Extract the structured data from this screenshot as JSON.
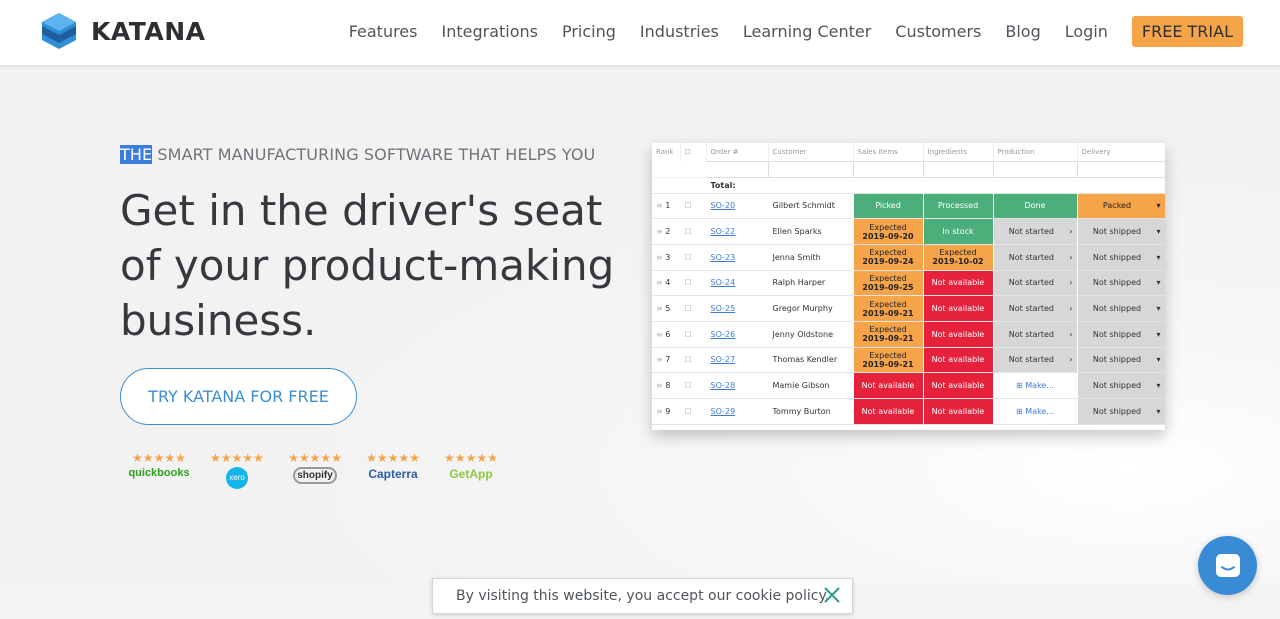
{
  "brand": {
    "logo_text": "KATANA"
  },
  "nav": {
    "items": [
      "Features",
      "Integrations",
      "Pricing",
      "Industries",
      "Learning Center",
      "Customers",
      "Blog",
      "Login"
    ],
    "cta": "FREE TRIAL"
  },
  "hero": {
    "eyebrow_highlight": "THE",
    "eyebrow_rest": " SMART MANUFACTURING SOFTWARE THAT HELPS YOU",
    "headline": "Get in the driver's seat of your product-making business.",
    "cta": "TRY KATANA FOR FREE"
  },
  "badges": [
    {
      "stars": "★★★★★",
      "label": "quickbooks",
      "icon": "quickbooks-logo"
    },
    {
      "stars": "★★★★★",
      "label": "xero",
      "icon": "xero-logo"
    },
    {
      "stars": "★★★★★",
      "label": "shopify",
      "icon": "shopify-logo"
    },
    {
      "stars": "★★★★★",
      "label": "Capterra",
      "icon": "capterra-logo"
    },
    {
      "stars": "★★★★★",
      "label": "GetApp",
      "icon": "getapp-logo"
    }
  ],
  "table": {
    "columns": [
      "Rank",
      "Order #",
      "Customer",
      "Sales items",
      "Ingredients",
      "Production",
      "Delivery"
    ],
    "total_label": "Total:",
    "rows": [
      {
        "rank": "1",
        "order": "SO-20",
        "customer": "Gilbert Schmidt",
        "sales": "Picked",
        "sales_status": "green",
        "ingredients": "Processed",
        "ingredients_status": "green",
        "production": "Done",
        "production_status": "green",
        "delivery": "Packed",
        "delivery_status": "orange"
      },
      {
        "rank": "2",
        "order": "SO-22",
        "customer": "Ellen Sparks",
        "sales": "Expected",
        "sales_date": "2019-09-20",
        "sales_status": "orange",
        "ingredients": "In stock",
        "ingredients_status": "green",
        "production": "Not started",
        "production_status": "grey",
        "delivery": "Not shipped",
        "delivery_status": "grey"
      },
      {
        "rank": "3",
        "order": "SO-23",
        "customer": "Jenna Smith",
        "sales": "Expected",
        "sales_date": "2019-09-24",
        "sales_status": "orange",
        "ingredients": "Expected",
        "ingredients_date": "2019-10-02",
        "ingredients_status": "orange",
        "production": "Not started",
        "production_status": "grey",
        "delivery": "Not shipped",
        "delivery_status": "grey"
      },
      {
        "rank": "4",
        "order": "SO-24",
        "customer": "Ralph Harper",
        "sales": "Expected",
        "sales_date": "2019-09-25",
        "sales_status": "orange",
        "ingredients": "Not available",
        "ingredients_status": "red",
        "production": "Not started",
        "production_status": "grey",
        "delivery": "Not shipped",
        "delivery_status": "grey"
      },
      {
        "rank": "5",
        "order": "SO-25",
        "customer": "Gregor Murphy",
        "sales": "Expected",
        "sales_date": "2019-09-21",
        "sales_status": "orange",
        "ingredients": "Not available",
        "ingredients_status": "red",
        "production": "Not started",
        "production_status": "grey",
        "delivery": "Not shipped",
        "delivery_status": "grey"
      },
      {
        "rank": "6",
        "order": "SO-26",
        "customer": "Jenny Oldstone",
        "sales": "Expected",
        "sales_date": "2019-09-21",
        "sales_status": "orange",
        "ingredients": "Not available",
        "ingredients_status": "red",
        "production": "Not started",
        "production_status": "grey",
        "delivery": "Not shipped",
        "delivery_status": "grey"
      },
      {
        "rank": "7",
        "order": "SO-27",
        "customer": "Thomas Kendler",
        "sales": "Expected",
        "sales_date": "2019-09-21",
        "sales_status": "orange",
        "ingredients": "Not available",
        "ingredients_status": "red",
        "production": "Not started",
        "production_status": "grey",
        "delivery": "Not shipped",
        "delivery_status": "grey"
      },
      {
        "rank": "8",
        "order": "SO-28",
        "customer": "Mamie Gibson",
        "sales": "Not available",
        "sales_status": "red",
        "ingredients": "Not available",
        "ingredients_status": "red",
        "production": "Make...",
        "production_status": "white",
        "delivery": "Not shipped",
        "delivery_status": "grey"
      },
      {
        "rank": "9",
        "order": "SO-29",
        "customer": "Tommy Burton",
        "sales": "Not available",
        "sales_status": "red",
        "ingredients": "Not available",
        "ingredients_status": "red",
        "production": "Make...",
        "production_status": "white",
        "delivery": "Not shipped",
        "delivery_status": "grey"
      }
    ]
  },
  "cookie": {
    "text": "By visiting this website, you accept our cookie policy."
  },
  "colors": {
    "accent_orange": "#f6a449",
    "accent_blue": "#3d8ed3",
    "status_green": "#4cae7a",
    "status_red": "#e5213c",
    "status_grey": "#d7d7d7"
  }
}
